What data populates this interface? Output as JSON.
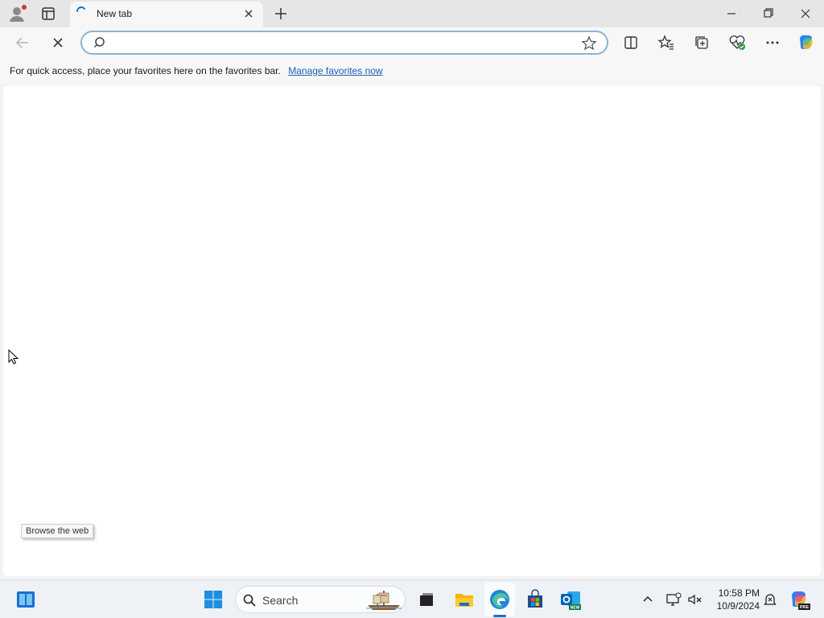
{
  "browser": {
    "tab": {
      "title": "New tab"
    },
    "address": {
      "value": "",
      "placeholder": ""
    },
    "favorites_bar": {
      "message": "For quick access, place your favorites here on the favorites bar.",
      "link_label": "Manage favorites now"
    }
  },
  "content": {
    "tooltip": "Browse the web"
  },
  "taskbar": {
    "search_label": "Search",
    "time": "10:58 PM",
    "date": "10/9/2024",
    "outlook_badge": "NEW",
    "copilot_badge": "PRE"
  },
  "colors": {
    "accent": "#1a6fd1",
    "link": "#1a5fb4",
    "notification_dot": "#d13438"
  },
  "icons": [
    "profile-icon",
    "workspaces-icon",
    "loading-spinner-icon",
    "close-icon",
    "plus-icon",
    "minimize-icon",
    "restore-icon",
    "back-arrow-icon",
    "stop-icon",
    "search-icon",
    "star-icon",
    "split-screen-icon",
    "favorites-icon",
    "collections-icon",
    "performance-icon",
    "more-icon",
    "copilot-icon",
    "widgets-icon",
    "windows-start-icon",
    "task-view-icon",
    "file-explorer-icon",
    "edge-icon",
    "store-icon",
    "outlook-icon",
    "chevron-up-icon",
    "network-icon",
    "volume-icon",
    "notification-icon"
  ]
}
